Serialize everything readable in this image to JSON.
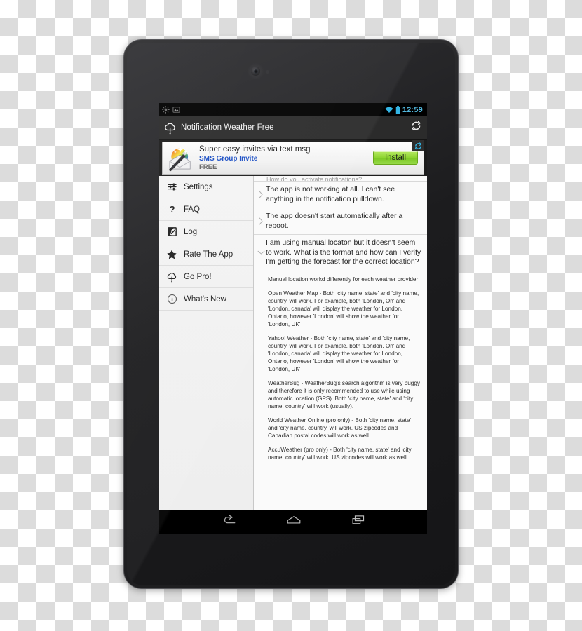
{
  "device": {
    "camera_icon": "front-camera",
    "sensor_icon": "proximity-sensor"
  },
  "statusbar": {
    "icons": [
      "brightness-icon",
      "screenshot-icon"
    ],
    "wifi_icon": "wifi-icon",
    "battery_icon": "battery-icon",
    "time": "12:59",
    "accent_color": "#51b7dd"
  },
  "appbar": {
    "logo_icon": "cloud-raindrop-logo",
    "title": "Notification Weather Free",
    "refresh_icon": "refresh-icon"
  },
  "ad": {
    "icon": "magic-wand-envelope-icon",
    "headline": "Super easy invites via text msg",
    "advertiser": "SMS Group Invite",
    "price": "FREE",
    "install_label": "Install",
    "refresh_badge_icon": "ad-refresh-icon",
    "advertiser_color": "#1a4ec4",
    "install_color": "#8fd633"
  },
  "sidebar": {
    "items": [
      {
        "label": "Settings",
        "icon": "sliders-icon"
      },
      {
        "label": "FAQ",
        "icon": "question-mark-icon"
      },
      {
        "label": "Log",
        "icon": "edit-square-icon"
      },
      {
        "label": "Rate The App",
        "icon": "star-icon"
      },
      {
        "label": "Go Pro!",
        "icon": "cloud-raindrop-icon"
      },
      {
        "label": "What's New",
        "icon": "info-circle-icon"
      }
    ]
  },
  "faq": {
    "clipped_item": "How do you activate notifications?",
    "questions": [
      {
        "text": "The app is not working at all. I can't see anything in the notification pulldown.",
        "expanded": false,
        "chevron": "chevron-right-icon"
      },
      {
        "text": "The app doesn't start automatically after a reboot.",
        "expanded": false,
        "chevron": "chevron-right-icon"
      },
      {
        "text": "I am using manual locaton but it doesn't seem to work. What is the format and how can I verify I'm getting the forecast for the correct location?",
        "expanded": true,
        "chevron": "chevron-down-icon"
      }
    ],
    "answer_paragraphs": [
      "Manual location workd differently for each weather provider:",
      "Open Weather Map - Both 'city name, state' and 'city name, country' will work. For example, both 'London, On' and 'London, canada' will display the weather for London, Ontario, however 'London' will show the weather for 'London, UK'",
      "Yahoo! Weather - Both 'city name, state' and 'city name, country' will work. For example, both 'London, On' and 'London, canada' will display the weather for London, Ontario, however 'London' will show the weather for 'London, UK'",
      "WeatherBug - WeatherBug's search algorithm is very buggy and therefore it is only recommended to use while using automatic location (GPS). Both 'city name, state' and 'city name, country' will work (usually).",
      "World Weather Online (pro only) - Both 'city name, state' and 'city name, country' will work. US zipcodes and Canadian postal codes will work as well.",
      "AccuWeather (pro only) - Both 'city name, state' and 'city name, country' will work. US zipcodes will work as well."
    ]
  },
  "navbar": {
    "buttons": [
      {
        "icon": "back-icon"
      },
      {
        "icon": "home-icon"
      },
      {
        "icon": "recents-icon"
      }
    ]
  }
}
